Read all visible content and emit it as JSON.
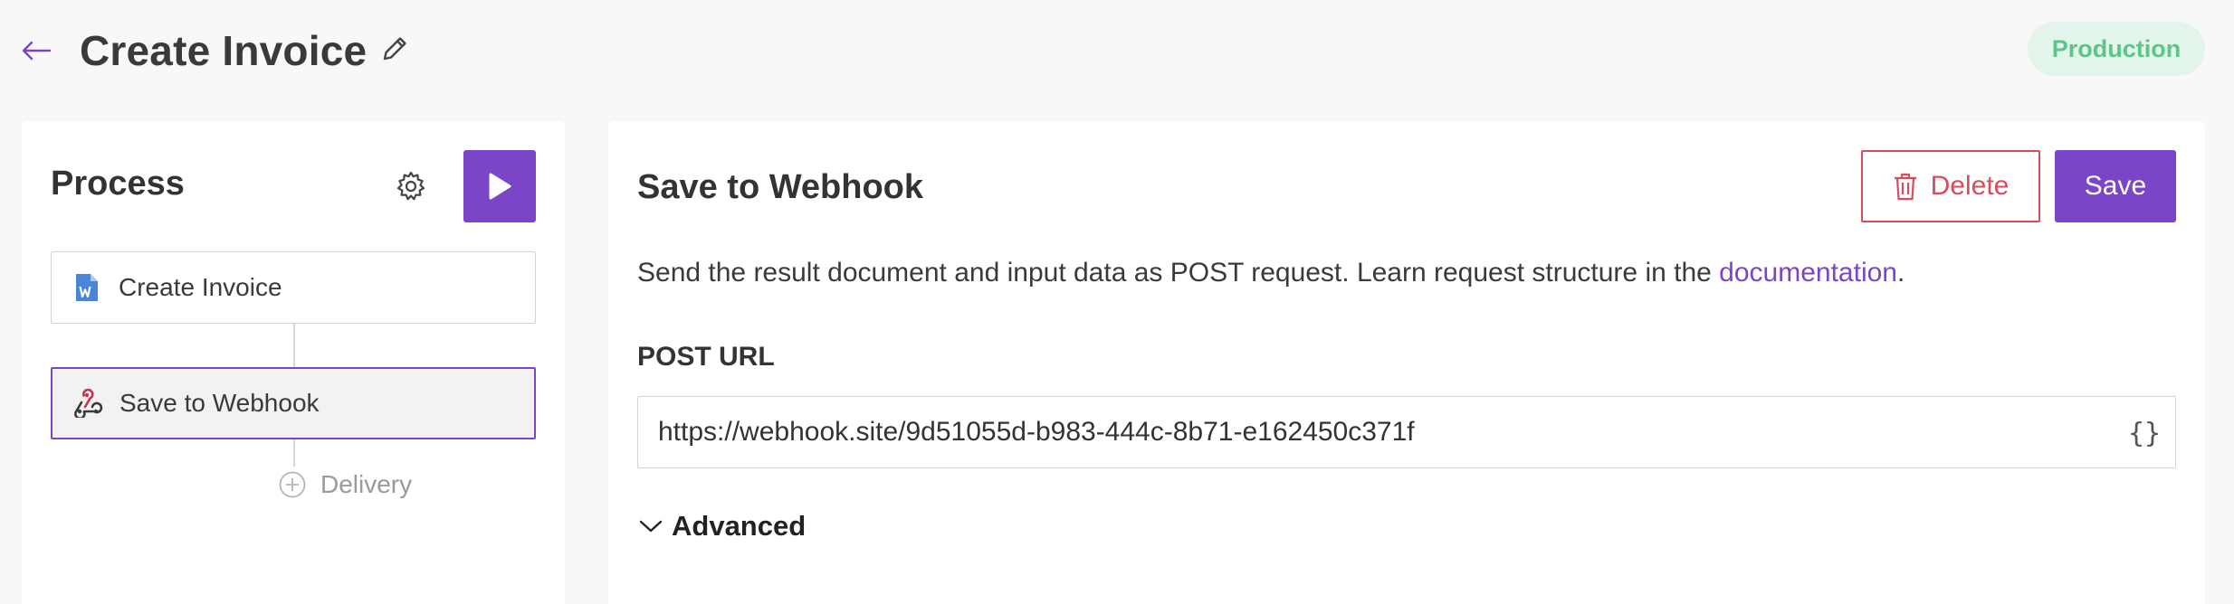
{
  "header": {
    "title": "Create Invoice",
    "environment_badge": "Production",
    "icons": {
      "back": "arrow-left-icon",
      "edit": "pencil-icon"
    }
  },
  "process_panel": {
    "title": "Process",
    "steps": [
      {
        "label": "Create Invoice",
        "icon": "word-document-icon",
        "selected": false
      },
      {
        "label": "Save to Webhook",
        "icon": "webhook-icon",
        "selected": true
      }
    ],
    "add_delivery_label": "Delivery",
    "icons": {
      "settings": "gear-icon",
      "run": "play-icon",
      "add": "plus-circle-icon"
    }
  },
  "detail_panel": {
    "title": "Save to Webhook",
    "delete_label": "Delete",
    "save_label": "Save",
    "description_text": "Send the result document and input data as POST request. Learn request structure in the ",
    "description_link": "documentation",
    "description_end": ".",
    "url_field": {
      "label": "POST URL",
      "value": "https://webhook.site/9d51055d-b983-444c-8b71-e162450c371f",
      "variables_button": "{}"
    },
    "advanced_label": "Advanced",
    "icons": {
      "delete": "trash-icon",
      "advanced": "chevron-down-icon"
    }
  },
  "colors": {
    "accent": "#7b45c7",
    "danger": "#d94b5e",
    "badge_bg": "#e3f4ea",
    "badge_text": "#5cc58a",
    "page_bg": "#f8f8f8"
  }
}
